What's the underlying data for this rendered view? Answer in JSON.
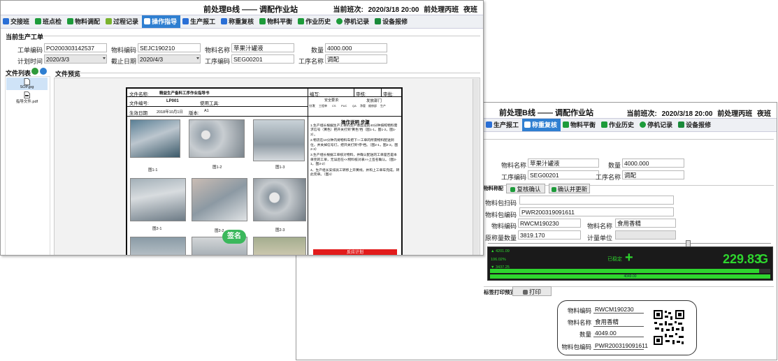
{
  "back_window": {
    "title": "前处理B线 —— 调配作业站",
    "shift_label": "当前班次:",
    "shift_time": "2020/3/18 20:00",
    "shift_team": "前处理丙班",
    "shift_type": "夜班",
    "tabs": [
      "生产报工",
      "称重复核",
      "物料平衡",
      "作业历史",
      "停机记录",
      "设备报修"
    ],
    "active_tab": "称重复核",
    "order": {
      "material_name_label": "物料名称",
      "material_name": "苹果汁罐液",
      "qty_label": "数量",
      "qty": "4000.000",
      "process_code_label": "工序编码",
      "process_code": "SEG00201",
      "process_name_label": "工序名称",
      "process_name": "调配"
    },
    "weigh_section_label": "物料称配",
    "recheck_button": "复核确认",
    "confirm_update_button": "确认并更新",
    "pkg_scan_label": "物料包扫码",
    "pkg_code_label": "物料包编码",
    "pkg_code": "PWR200319091611",
    "mat_code_label": "物料编码",
    "mat_code": "RWCM190230",
    "mat_name_label": "物料名称",
    "mat_name": "食用香精",
    "orig_qty_label": "原称量数量",
    "orig_qty": "3819.170",
    "unit_label": "计量单位",
    "scale": {
      "upper": "4201.09",
      "percent": "106.02%",
      "lower": "3437.25",
      "stable": "已稳定",
      "sign": "+",
      "value": "229.83",
      "unit": "G",
      "bar_value": "4049.00",
      "progress": 0.96
    },
    "label_print_label": "标签打印预览",
    "print_button": "打印",
    "label_card": {
      "mat_code_label": "物料编码",
      "mat_code": "RWCM190230",
      "mat_name_label": "物料名称",
      "mat_name": "食用香精",
      "qty_label": "数量",
      "qty": "4049.00",
      "pkg_code_label": "物料包编码",
      "pkg_code": "PWR200319091611"
    }
  },
  "front_window": {
    "title": "前处理B线 —— 调配作业站",
    "shift_label": "当前班次:",
    "shift_time": "2020/3/18 20:00",
    "shift_team": "前处理丙班",
    "shift_type": "夜班",
    "tabs": [
      "交接班",
      "班点检",
      "物料调配",
      "过程记录",
      "操作指导",
      "生产报工",
      "称重复核",
      "物料平衡",
      "作业历史",
      "停机记录",
      "设备报修"
    ],
    "active_tab": "操作指导",
    "order_section": "当前生产工单",
    "order": {
      "order_code_label": "工单编码",
      "order_code": "PO200303142537",
      "material_code_label": "物料编码",
      "material_code": "SEJC190210",
      "material_name_label": "物料名称",
      "material_name": "苹果汁罐液",
      "qty_label": "数量",
      "qty": "4000.000",
      "plan_time_label": "计划时间",
      "plan_time": "2020/3/3",
      "due_date_label": "截止日期",
      "due_date": "2020/4/3",
      "process_code_label": "工序编码",
      "process_code": "SEG00201",
      "process_name_label": "工序名称",
      "process_name": "调配"
    },
    "file_list_label": "文件列表",
    "files": [
      "SOP.jpg",
      "指导文件.pdf"
    ],
    "file_preview_label": "文件预览",
    "document": {
      "file_name_label": "文件名称:",
      "file_name": "精益生产备料工序作业指导书",
      "file_no_label": "文件编号:",
      "file_no": "LP001",
      "tools_label": "使用工具:",
      "effective_label": "生效日期",
      "effective": "2018年10月1日",
      "version_label": "版本:",
      "version": "A1",
      "author_label": "编写:",
      "review_label": "审核:",
      "approve_label": "审批:",
      "safety_label": "安全要求:",
      "dept_label": "发放部门",
      "dept_cols": [
        "工程单",
        "CS",
        "PUC",
        "QA",
        "净管",
        "维修部",
        "生产"
      ],
      "dist_label": "分发",
      "photo_caps": [
        "图1-1",
        "图1-2",
        "图1-3",
        "图2-1",
        "图2-2",
        "图2-3"
      ],
      "steps_title": "操作说明 步骤",
      "steps": [
        "1.生产组长根据生产工单的生产进度提前40分钟按照物料需求信号（黄色）把开关打到\"黄色\"档（图1-1，图1-2，图1-3）。",
        "2.物流在10分钟内将物料车把下一工单的所需物料配送到位，并关掉信号灯，把开关打到\"停\"档。（图2-1，图2-2，图2-3）",
        "3.生产组长根据工单核对物料，并确认配送的工单是否是本单完的工单，无误后在<<物料核对表>>上签名确认。（图3-1，图3-2）",
        "4、生产组长安排员工转移上开黄线，并和上工单车完成，转此完单。（图4）"
      ],
      "sign_stamp": "签名",
      "red_bar": "反应计划"
    }
  }
}
